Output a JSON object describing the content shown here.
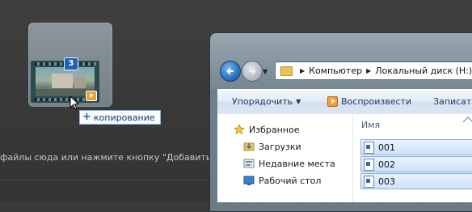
{
  "background_app": {
    "hint_text": "файлы сюда или нажмите кнопку \"Добавить\". Чтоб"
  },
  "drag": {
    "item_count": "3",
    "tooltip_label": "копирование",
    "tooltip_icon": "plus-icon"
  },
  "explorer": {
    "address": {
      "segments": [
        "Компьютер",
        "Локальный диск (H:)"
      ]
    },
    "toolbar": {
      "organize_label": "Упорядочить",
      "play_label": "Воспроизвести",
      "record_label": "Записать"
    },
    "nav": {
      "favorites": "Избранное",
      "downloads": "Загрузки",
      "recent": "Недавние места",
      "desktop": "Рабочий стол"
    },
    "columns": {
      "name_header": "Имя"
    },
    "files": [
      "001",
      "002",
      "003"
    ]
  },
  "colors": {
    "accent_blue": "#1d63b8",
    "selection_fill": "#cfe2f9",
    "selection_border": "#85aee0",
    "play_orange": "#f2a033"
  }
}
